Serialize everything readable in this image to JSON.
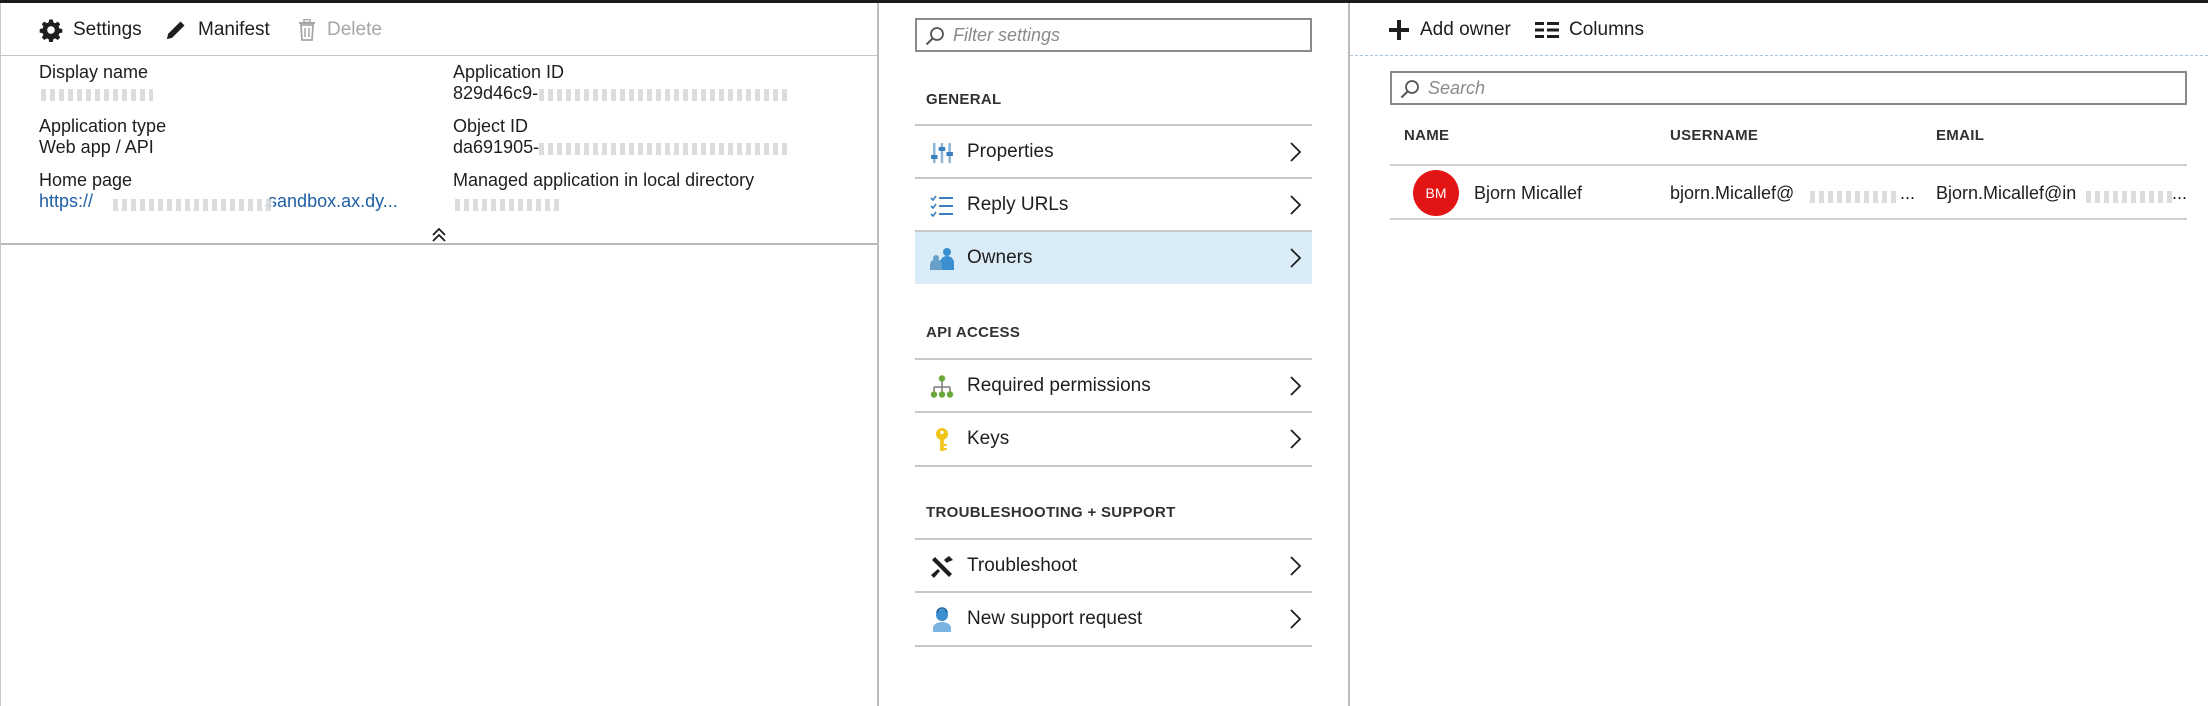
{
  "app_blade": {
    "toolbar": {
      "settings_label": "Settings",
      "manifest_label": "Manifest",
      "delete_label": "Delete"
    },
    "essentials": {
      "display_name_label": "Display name",
      "display_name_value": "",
      "application_id_label": "Application ID",
      "application_id_value": "829d46c9-",
      "application_type_label": "Application type",
      "application_type_value": "Web app / API",
      "object_id_label": "Object ID",
      "object_id_value": "da691905-",
      "home_page_label": "Home page",
      "home_page_value_start": "https://",
      "home_page_value_end": ".sandbox.ax.dy...",
      "managed_app_label": "Managed application in local directory",
      "managed_app_value": ""
    }
  },
  "settings_blade": {
    "filter_placeholder": "Filter settings",
    "sections": [
      {
        "title": "GENERAL",
        "items": [
          {
            "label": "Properties",
            "icon": "properties-icon"
          },
          {
            "label": "Reply URLs",
            "icon": "reply-urls-icon"
          },
          {
            "label": "Owners",
            "icon": "owners-icon",
            "selected": true
          }
        ]
      },
      {
        "title": "API ACCESS",
        "items": [
          {
            "label": "Required permissions",
            "icon": "permissions-icon"
          },
          {
            "label": "Keys",
            "icon": "key-icon"
          }
        ]
      },
      {
        "title": "TROUBLESHOOTING + SUPPORT",
        "items": [
          {
            "label": "Troubleshoot",
            "icon": "troubleshoot-icon"
          },
          {
            "label": "New support request",
            "icon": "support-request-icon"
          }
        ]
      }
    ]
  },
  "owners_blade": {
    "toolbar": {
      "add_owner_label": "Add owner",
      "columns_label": "Columns"
    },
    "search_placeholder": "Search",
    "columns": [
      "NAME",
      "USERNAME",
      "EMAIL"
    ],
    "rows": [
      {
        "initials": "BM",
        "name": "Bjorn Micallef",
        "username": "bjorn.Micallef@",
        "email": "Bjorn.Micallef@in",
        "avatar_color": "#e31414"
      }
    ]
  },
  "colors": {
    "selected_row": "#dbecf9",
    "link": "#1f5fa6",
    "icon_blue": "#3a8fd1",
    "icon_green": "#68a83a",
    "icon_yellow": "#f0c419"
  }
}
